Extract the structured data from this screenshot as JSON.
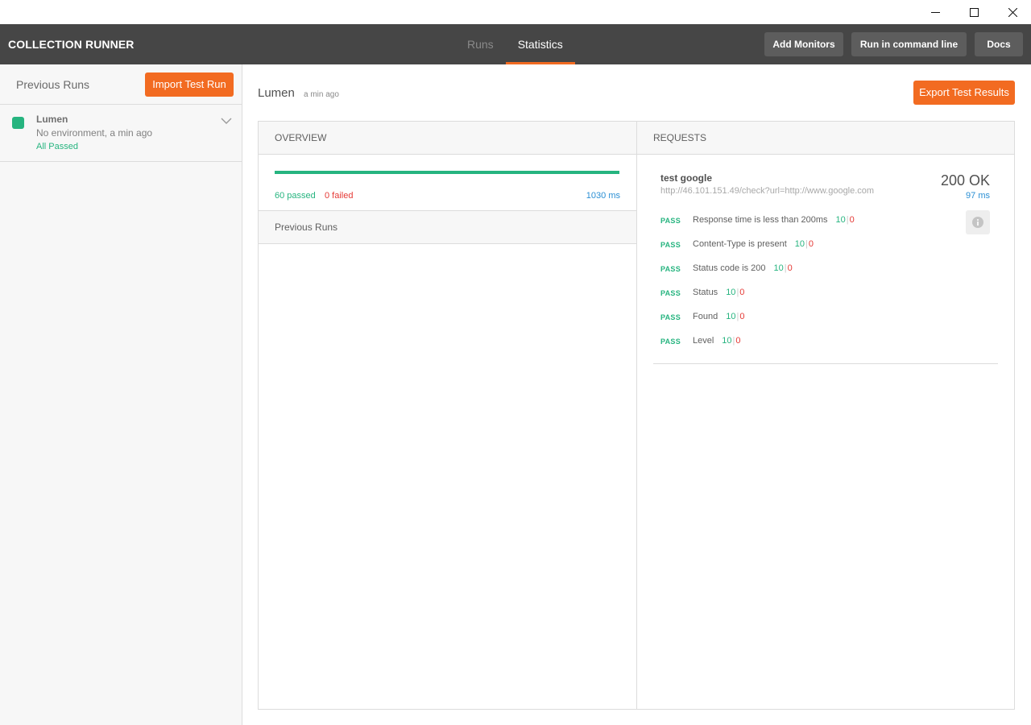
{
  "window": {
    "minimize_icon": "minimize-icon",
    "maximize_icon": "maximize-icon",
    "close_icon": "close-icon"
  },
  "header": {
    "app_title": "COLLECTION RUNNER",
    "tabs": [
      {
        "label": "Runs",
        "active": false
      },
      {
        "label": "Statistics",
        "active": true
      }
    ],
    "buttons": {
      "add_monitors": "Add Monitors",
      "run_command_line": "Run in command line",
      "docs": "Docs"
    },
    "colors": {
      "header_bg": "#464646",
      "accent": "#f26b21"
    }
  },
  "sidebar": {
    "title": "Previous Runs",
    "import_button": "Import Test Run",
    "runs": [
      {
        "name": "Lumen",
        "environment": "No environment, a min ago",
        "status": "All Passed",
        "status_color": "#26b47f"
      }
    ]
  },
  "main": {
    "run_title": "Lumen",
    "run_time": "a min ago",
    "export_button": "Export Test Results",
    "overview": {
      "heading": "OVERVIEW",
      "progress_passed_fraction": 1.0,
      "passed": "60 passed",
      "failed": "0 failed",
      "duration": "1030 ms",
      "previous_runs_heading": "Previous Runs"
    },
    "requests": {
      "heading": "REQUESTS",
      "items": [
        {
          "name": "test google",
          "url": "http://46.101.151.49/check?url=http://www.google.com",
          "status": "200 OK",
          "time": "97 ms",
          "tests": [
            {
              "result": "PASS",
              "name": "Response time is less than 200ms",
              "pass": "10",
              "fail": "0"
            },
            {
              "result": "PASS",
              "name": "Content-Type is present",
              "pass": "10",
              "fail": "0"
            },
            {
              "result": "PASS",
              "name": "Status code is 200",
              "pass": "10",
              "fail": "0"
            },
            {
              "result": "PASS",
              "name": "Status",
              "pass": "10",
              "fail": "0"
            },
            {
              "result": "PASS",
              "name": "Found",
              "pass": "10",
              "fail": "0"
            },
            {
              "result": "PASS",
              "name": "Level",
              "pass": "10",
              "fail": "0"
            }
          ]
        }
      ]
    }
  }
}
